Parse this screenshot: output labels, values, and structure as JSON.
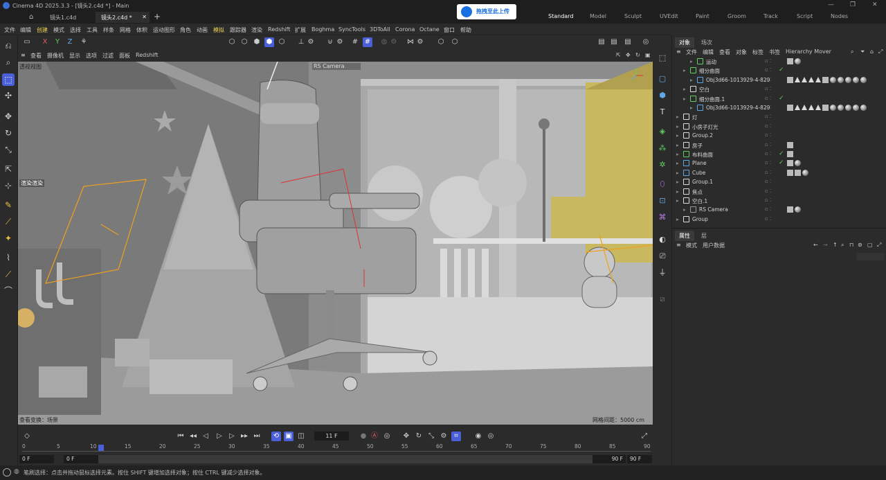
{
  "window": {
    "title": "Cinema 4D 2025.3.3 - [镜头2.c4d *] - Main"
  },
  "file_tabs": [
    {
      "label": "镜头1.c4d"
    },
    {
      "label": "镜头2.c4d *"
    }
  ],
  "upload_button": "拖拽至此上传",
  "layouts": [
    "Standard",
    "Model",
    "Sculpt",
    "UVEdit",
    "Paint",
    "Groom",
    "Track",
    "Script",
    "Nodes"
  ],
  "menu": [
    "文件",
    "编辑",
    "创建",
    "模式",
    "选择",
    "工具",
    "样条",
    "网格",
    "体积",
    "运动图形",
    "角色",
    "动画",
    "模拟",
    "跟踪器",
    "渲染",
    "Redshift",
    "扩展",
    "Boghma",
    "SyncTools",
    "3DToAll",
    "Corona",
    "Octane",
    "窗口",
    "帮助"
  ],
  "axes": [
    "X",
    "Y",
    "Z"
  ],
  "viewport_menu": [
    "查看",
    "摄像机",
    "显示",
    "选项",
    "过滤",
    "面板",
    "Redshift"
  ],
  "viewport": {
    "name": "透视视图",
    "camera": "RS Camera",
    "grid": "网格间距：5000 cm",
    "transform": "查看变换：场景",
    "render_tag": "渲染渲染"
  },
  "timeline": {
    "current_frame": "11 F",
    "start": "0 F",
    "range_start": "0 F",
    "range_end": "90 F",
    "end": "90 F",
    "ticks": [
      "0",
      "5",
      "10",
      "15",
      "20",
      "25",
      "30",
      "35",
      "40",
      "45",
      "50",
      "55",
      "60",
      "65",
      "70",
      "75",
      "80",
      "85",
      "90"
    ]
  },
  "object_panel": {
    "tabs": [
      "对象",
      "场次"
    ],
    "menu": [
      "文件",
      "编辑",
      "查看",
      "对象",
      "标签",
      "书签",
      "Hierarchy Mover"
    ],
    "rows": [
      {
        "name": "运动",
        "indent": 2,
        "icon": "#5fcf5f",
        "check": false,
        "tags": "ball"
      },
      {
        "name": "细分曲面",
        "indent": 1,
        "icon": "#5fcf5f",
        "check": true,
        "tags": ""
      },
      {
        "name": "Obj3d66-1013929-4-829",
        "indent": 2,
        "icon": "#5fa8e8",
        "check": false,
        "tags": "tri"
      },
      {
        "name": "空白",
        "indent": 1,
        "icon": "#ddd",
        "check": false,
        "tags": ""
      },
      {
        "name": "细分曲面.1",
        "indent": 1,
        "icon": "#5fcf5f",
        "check": true,
        "tags": ""
      },
      {
        "name": "Obj3d66-1013929-4-829",
        "indent": 2,
        "icon": "#5fa8e8",
        "check": false,
        "tags": "tri"
      },
      {
        "name": "灯",
        "indent": 0,
        "icon": "#ddd",
        "check": false,
        "tags": ""
      },
      {
        "name": "小房子灯光",
        "indent": 0,
        "icon": "#ddd",
        "check": false,
        "tags": ""
      },
      {
        "name": "Group.2",
        "indent": 0,
        "icon": "#ddd",
        "check": false,
        "tags": ""
      },
      {
        "name": "房子",
        "indent": 0,
        "icon": "#ddd",
        "check": false,
        "tags": "flag"
      },
      {
        "name": "布料曲面",
        "indent": 0,
        "icon": "#5fcf5f",
        "check": true,
        "tags": "grid"
      },
      {
        "name": "Plane",
        "indent": 0,
        "icon": "#5fa8e8",
        "check": true,
        "tags": "mat"
      },
      {
        "name": "Cube",
        "indent": 0,
        "icon": "#5fa8e8",
        "check": false,
        "tags": "mat2"
      },
      {
        "name": "Group.1",
        "indent": 0,
        "icon": "#ddd",
        "check": false,
        "tags": ""
      },
      {
        "name": "焦点",
        "indent": 0,
        "icon": "#ddd",
        "check": false,
        "tags": ""
      },
      {
        "name": "空白.1",
        "indent": 0,
        "icon": "#ddd",
        "check": false,
        "tags": ""
      },
      {
        "name": "RS Camera",
        "indent": 1,
        "icon": "#999",
        "check": false,
        "tags": "cam"
      },
      {
        "name": "Group",
        "indent": 0,
        "icon": "#ddd",
        "check": false,
        "tags": ""
      }
    ]
  },
  "attributes_panel": {
    "tabs": [
      "属性",
      "层"
    ],
    "menu": [
      "模式",
      "用户数据"
    ]
  },
  "status": "笔刷选择：点击并拖动鼠标选择元素。按住 SHIFT 键增加选择对象；按住 CTRL 键减少选择对象。"
}
